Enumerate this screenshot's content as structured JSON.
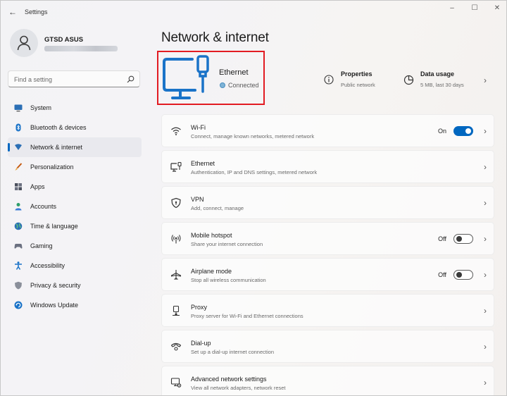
{
  "window": {
    "app_title": "Settings",
    "back_glyph": "←",
    "min_glyph": "–",
    "max_glyph": "☐",
    "close_glyph": "✕"
  },
  "profile": {
    "name": "GTSD ASUS"
  },
  "search": {
    "placeholder": "Find a setting"
  },
  "sidebar": {
    "items": [
      {
        "label": "System",
        "icon": "system-icon"
      },
      {
        "label": "Bluetooth & devices",
        "icon": "bluetooth-icon"
      },
      {
        "label": "Network & internet",
        "icon": "network-icon",
        "selected": true
      },
      {
        "label": "Personalization",
        "icon": "brush-icon"
      },
      {
        "label": "Apps",
        "icon": "apps-icon"
      },
      {
        "label": "Accounts",
        "icon": "accounts-icon"
      },
      {
        "label": "Time & language",
        "icon": "globe-clock-icon"
      },
      {
        "label": "Gaming",
        "icon": "gamepad-icon"
      },
      {
        "label": "Accessibility",
        "icon": "accessibility-icon"
      },
      {
        "label": "Privacy & security",
        "icon": "shield-icon"
      },
      {
        "label": "Windows Update",
        "icon": "update-icon"
      }
    ]
  },
  "main": {
    "title": "Network & internet",
    "connection": {
      "name": "Ethernet",
      "status": "Connected"
    },
    "properties": {
      "title": "Properties",
      "subtitle": "Public network"
    },
    "data_usage": {
      "title": "Data usage",
      "subtitle": "5 MB, last 30 days"
    },
    "chevron": "›",
    "cards": [
      {
        "title": "Wi-Fi",
        "subtitle": "Connect, manage known networks, metered network",
        "state": "On",
        "toggle": "on",
        "icon": "wifi-icon"
      },
      {
        "title": "Ethernet",
        "subtitle": "Authentication, IP and DNS settings, metered network",
        "icon": "ethernet-icon"
      },
      {
        "title": "VPN",
        "subtitle": "Add, connect, manage",
        "icon": "vpn-shield-icon"
      },
      {
        "title": "Mobile hotspot",
        "subtitle": "Share your internet connection",
        "state": "Off",
        "toggle": "off",
        "icon": "hotspot-icon"
      },
      {
        "title": "Airplane mode",
        "subtitle": "Stop all wireless communication",
        "state": "Off",
        "toggle": "off",
        "icon": "airplane-icon"
      },
      {
        "title": "Proxy",
        "subtitle": "Proxy server for Wi-Fi and Ethernet connections",
        "icon": "proxy-icon"
      },
      {
        "title": "Dial-up",
        "subtitle": "Set up a dial-up internet connection",
        "icon": "dialup-icon"
      },
      {
        "title": "Advanced network settings",
        "subtitle": "View all network adapters, network reset",
        "icon": "advanced-network-icon"
      }
    ]
  },
  "colors": {
    "accent": "#0067c0",
    "highlight_box": "#e21b22"
  }
}
